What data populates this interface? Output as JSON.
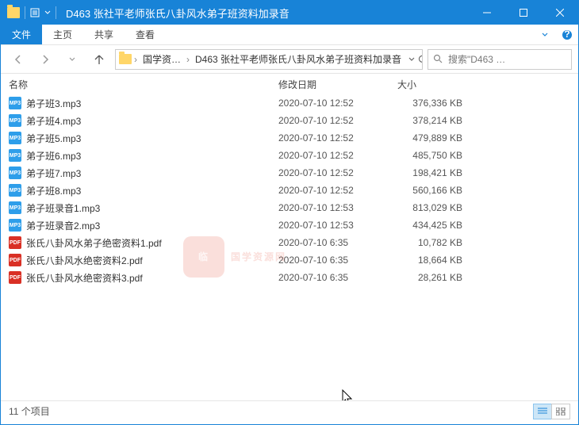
{
  "window": {
    "title": "D463 张社平老师张氏八卦风水弟子班资料加录音"
  },
  "ribbon": {
    "file": "文件",
    "tabs": [
      "主页",
      "共享",
      "查看"
    ]
  },
  "breadcrumb": {
    "items": [
      "国学资…",
      "D463 张社平老师张氏八卦风水弟子班资料加录音"
    ]
  },
  "search": {
    "placeholder": "搜索\"D463 …"
  },
  "columns": {
    "name": "名称",
    "date": "修改日期",
    "size": "大小"
  },
  "files": [
    {
      "icon": "mp3",
      "name": "弟子班3.mp3",
      "date": "2020-07-10 12:52",
      "size": "376,336 KB"
    },
    {
      "icon": "mp3",
      "name": "弟子班4.mp3",
      "date": "2020-07-10 12:52",
      "size": "378,214 KB"
    },
    {
      "icon": "mp3",
      "name": "弟子班5.mp3",
      "date": "2020-07-10 12:52",
      "size": "479,889 KB"
    },
    {
      "icon": "mp3",
      "name": "弟子班6.mp3",
      "date": "2020-07-10 12:52",
      "size": "485,750 KB"
    },
    {
      "icon": "mp3",
      "name": "弟子班7.mp3",
      "date": "2020-07-10 12:52",
      "size": "198,421 KB"
    },
    {
      "icon": "mp3",
      "name": "弟子班8.mp3",
      "date": "2020-07-10 12:52",
      "size": "560,166 KB"
    },
    {
      "icon": "mp3",
      "name": "弟子班录音1.mp3",
      "date": "2020-07-10 12:53",
      "size": "813,029 KB"
    },
    {
      "icon": "mp3",
      "name": "弟子班录音2.mp3",
      "date": "2020-07-10 12:53",
      "size": "434,425 KB"
    },
    {
      "icon": "pdf",
      "name": "张氏八卦风水弟子绝密资料1.pdf",
      "date": "2020-07-10 6:35",
      "size": "10,782 KB"
    },
    {
      "icon": "pdf",
      "name": "张氏八卦风水绝密资料2.pdf",
      "date": "2020-07-10 6:35",
      "size": "18,664 KB"
    },
    {
      "icon": "pdf",
      "name": "张氏八卦风水绝密资料3.pdf",
      "date": "2020-07-10 6:35",
      "size": "28,261 KB"
    }
  ],
  "status": {
    "count": "11 个项目"
  },
  "watermark": {
    "badge": "临",
    "text": "国学资源网"
  },
  "iconLabels": {
    "mp3": "MP3",
    "pdf": "PDF"
  }
}
